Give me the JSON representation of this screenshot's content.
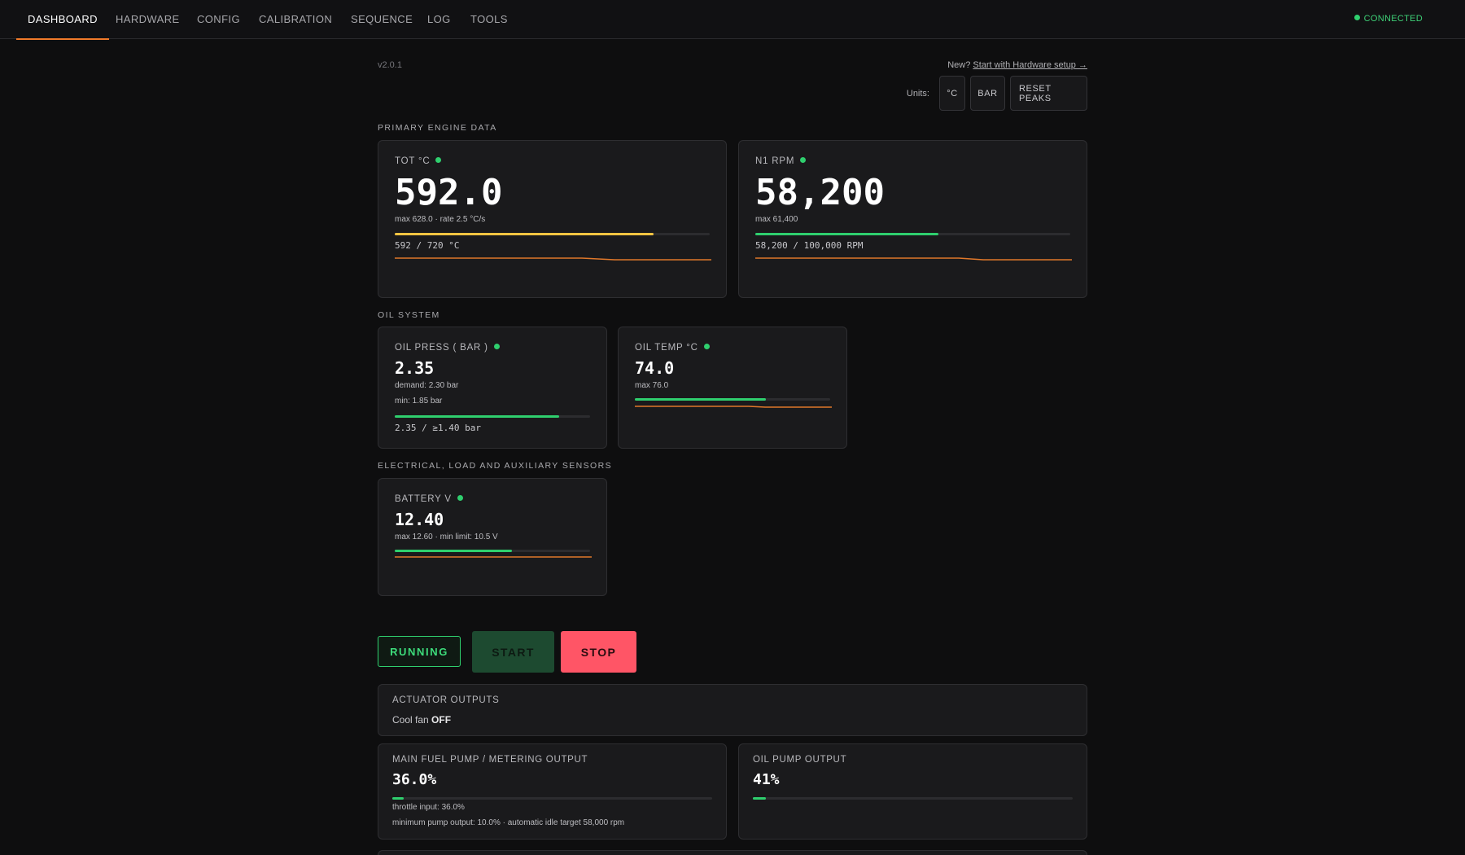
{
  "nav": {
    "tabs": [
      "DASHBOARD",
      "HARDWARE",
      "CONFIG",
      "CALIBRATION",
      "SEQUENCE",
      "LOG",
      "TOOLS"
    ],
    "active_tab": "DASHBOARD",
    "status": "CONNECTED"
  },
  "header": {
    "version": "v2.0.1",
    "new_prefix": "New?",
    "setup_link": "Start with Hardware setup →",
    "units_label": "Units:",
    "unit_temp": "°C",
    "unit_press": "BAR",
    "reset_peaks": "RESET PEAKS"
  },
  "sections": {
    "primary": "PRIMARY ENGINE DATA",
    "oil": "OIL SYSTEM",
    "electrical": "ELECTRICAL, LOAD AND AUXILIARY SENSORS"
  },
  "gauges": {
    "tot": {
      "label": "TOT  °C",
      "value": "592.0",
      "sub": "max 628.0 · rate 2.5 °C/s",
      "range": "592 / 720 °C",
      "fraction": 0.822,
      "color": "#f5c542"
    },
    "n1": {
      "label": "N1 RPM",
      "value": "58,200",
      "sub": "max 61,400",
      "range": "58,200 / 100,000 RPM",
      "fraction": 0.582,
      "color": "#2fcf6e"
    },
    "oil_press": {
      "label": "OIL PRESS ( BAR )",
      "value": "2.35",
      "sub1": "demand: 2.30 bar",
      "sub2": "min: 1.85 bar",
      "range": "2.35 / ≥1.40 bar",
      "fraction": 0.84,
      "color": "#2fcf6e"
    },
    "oil_temp": {
      "label": "OIL TEMP  °C",
      "value": "74.0",
      "sub": "max 76.0",
      "fraction": 0.67,
      "color": "#2fcf6e"
    },
    "battery": {
      "label": "BATTERY V",
      "value": "12.40",
      "sub": "max 12.60 · min limit: 10.5 V",
      "fraction": 0.6,
      "color": "#2fcf6e"
    }
  },
  "controls": {
    "state": "RUNNING",
    "start": "START",
    "stop": "STOP"
  },
  "actuators": {
    "title": "ACTUATOR OUTPUTS",
    "fan_label": "Cool fan",
    "fan_state": "OFF"
  },
  "fuel_pump": {
    "title": "MAIN FUEL PUMP / METERING OUTPUT",
    "value": "36.0%",
    "fraction": 0.036,
    "throttle": "throttle input: 36.0%",
    "minimum": "minimum pump output: 10.0% · automatic idle target 58,000 rpm"
  },
  "oil_pump": {
    "title": "OIL PUMP OUTPUT",
    "value": "41%",
    "fraction": 0.041
  },
  "colors": {
    "accent": "#f07a2a",
    "ok": "#2fcf6e",
    "warn": "#f5c542",
    "stop": "#ff5566",
    "spark": "#e0782a"
  }
}
